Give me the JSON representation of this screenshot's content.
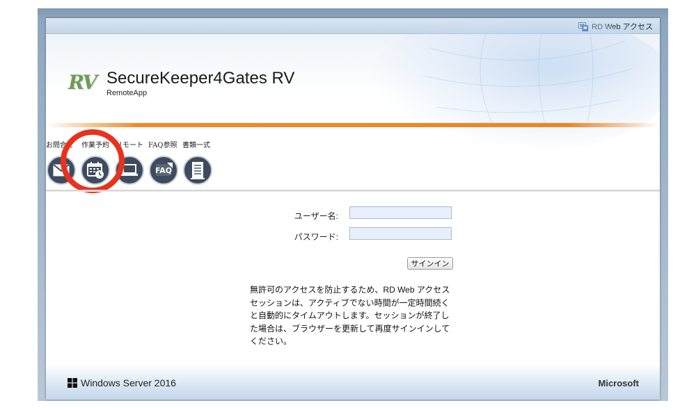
{
  "topbar": {
    "link_label": "RD Web アクセス",
    "icon": "rd-web-icon"
  },
  "header": {
    "logo_text": "RV",
    "title": "SecureKeeper4Gates RV",
    "subtitle": "RemoteApp"
  },
  "menu": {
    "items": [
      {
        "label": "お問合せ",
        "icon": "mail-icon"
      },
      {
        "label": "作業予約",
        "icon": "calendar-clock-icon"
      },
      {
        "label": "リモート",
        "icon": "laptop-icon"
      },
      {
        "label": "FAQ参照",
        "icon": "faq-icon"
      },
      {
        "label": "書類一式",
        "icon": "documents-icon"
      }
    ]
  },
  "form": {
    "username_label": "ユーザー名:",
    "username_value": "",
    "password_label": "パスワード:",
    "password_value": "",
    "signin_label": "サインイン"
  },
  "notice": "無許可のアクセスを防止するため、RD Web アクセス セッションは、アクティブでない時間が一定時間続くと自動的にタイムアウトします。セッションが終了した場合は、ブラウザーを更新して再度サインインしてください。",
  "footer": {
    "os_label": "Windows Server 2016",
    "vendor_label": "Microsoft"
  },
  "colors": {
    "accent_orange": "#f08a28",
    "highlight_red": "#e8321e",
    "icon_bg": "#3e4b5e"
  }
}
